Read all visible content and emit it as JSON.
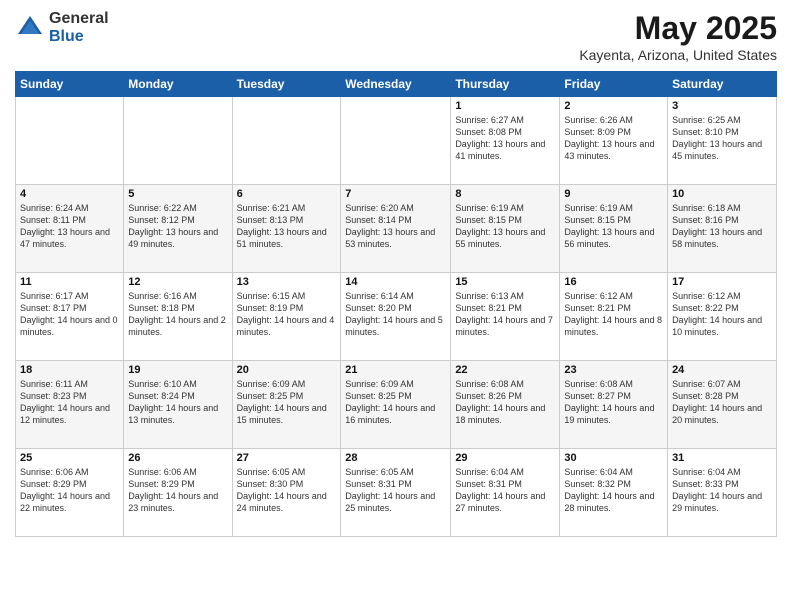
{
  "header": {
    "logo_general": "General",
    "logo_blue": "Blue",
    "main_title": "May 2025",
    "subtitle": "Kayenta, Arizona, United States"
  },
  "calendar": {
    "days_of_week": [
      "Sunday",
      "Monday",
      "Tuesday",
      "Wednesday",
      "Thursday",
      "Friday",
      "Saturday"
    ],
    "weeks": [
      [
        {
          "day": "",
          "info": ""
        },
        {
          "day": "",
          "info": ""
        },
        {
          "day": "",
          "info": ""
        },
        {
          "day": "",
          "info": ""
        },
        {
          "day": "1",
          "info": "Sunrise: 6:27 AM\nSunset: 8:08 PM\nDaylight: 13 hours\nand 41 minutes."
        },
        {
          "day": "2",
          "info": "Sunrise: 6:26 AM\nSunset: 8:09 PM\nDaylight: 13 hours\nand 43 minutes."
        },
        {
          "day": "3",
          "info": "Sunrise: 6:25 AM\nSunset: 8:10 PM\nDaylight: 13 hours\nand 45 minutes."
        }
      ],
      [
        {
          "day": "4",
          "info": "Sunrise: 6:24 AM\nSunset: 8:11 PM\nDaylight: 13 hours\nand 47 minutes."
        },
        {
          "day": "5",
          "info": "Sunrise: 6:22 AM\nSunset: 8:12 PM\nDaylight: 13 hours\nand 49 minutes."
        },
        {
          "day": "6",
          "info": "Sunrise: 6:21 AM\nSunset: 8:13 PM\nDaylight: 13 hours\nand 51 minutes."
        },
        {
          "day": "7",
          "info": "Sunrise: 6:20 AM\nSunset: 8:14 PM\nDaylight: 13 hours\nand 53 minutes."
        },
        {
          "day": "8",
          "info": "Sunrise: 6:19 AM\nSunset: 8:15 PM\nDaylight: 13 hours\nand 55 minutes."
        },
        {
          "day": "9",
          "info": "Sunrise: 6:19 AM\nSunset: 8:15 PM\nDaylight: 13 hours\nand 56 minutes."
        },
        {
          "day": "10",
          "info": "Sunrise: 6:18 AM\nSunset: 8:16 PM\nDaylight: 13 hours\nand 58 minutes."
        }
      ],
      [
        {
          "day": "11",
          "info": "Sunrise: 6:17 AM\nSunset: 8:17 PM\nDaylight: 14 hours\nand 0 minutes."
        },
        {
          "day": "12",
          "info": "Sunrise: 6:16 AM\nSunset: 8:18 PM\nDaylight: 14 hours\nand 2 minutes."
        },
        {
          "day": "13",
          "info": "Sunrise: 6:15 AM\nSunset: 8:19 PM\nDaylight: 14 hours\nand 4 minutes."
        },
        {
          "day": "14",
          "info": "Sunrise: 6:14 AM\nSunset: 8:20 PM\nDaylight: 14 hours\nand 5 minutes."
        },
        {
          "day": "15",
          "info": "Sunrise: 6:13 AM\nSunset: 8:21 PM\nDaylight: 14 hours\nand 7 minutes."
        },
        {
          "day": "16",
          "info": "Sunrise: 6:12 AM\nSunset: 8:21 PM\nDaylight: 14 hours\nand 8 minutes."
        },
        {
          "day": "17",
          "info": "Sunrise: 6:12 AM\nSunset: 8:22 PM\nDaylight: 14 hours\nand 10 minutes."
        }
      ],
      [
        {
          "day": "18",
          "info": "Sunrise: 6:11 AM\nSunset: 8:23 PM\nDaylight: 14 hours\nand 12 minutes."
        },
        {
          "day": "19",
          "info": "Sunrise: 6:10 AM\nSunset: 8:24 PM\nDaylight: 14 hours\nand 13 minutes."
        },
        {
          "day": "20",
          "info": "Sunrise: 6:09 AM\nSunset: 8:25 PM\nDaylight: 14 hours\nand 15 minutes."
        },
        {
          "day": "21",
          "info": "Sunrise: 6:09 AM\nSunset: 8:25 PM\nDaylight: 14 hours\nand 16 minutes."
        },
        {
          "day": "22",
          "info": "Sunrise: 6:08 AM\nSunset: 8:26 PM\nDaylight: 14 hours\nand 18 minutes."
        },
        {
          "day": "23",
          "info": "Sunrise: 6:08 AM\nSunset: 8:27 PM\nDaylight: 14 hours\nand 19 minutes."
        },
        {
          "day": "24",
          "info": "Sunrise: 6:07 AM\nSunset: 8:28 PM\nDaylight: 14 hours\nand 20 minutes."
        }
      ],
      [
        {
          "day": "25",
          "info": "Sunrise: 6:06 AM\nSunset: 8:29 PM\nDaylight: 14 hours\nand 22 minutes."
        },
        {
          "day": "26",
          "info": "Sunrise: 6:06 AM\nSunset: 8:29 PM\nDaylight: 14 hours\nand 23 minutes."
        },
        {
          "day": "27",
          "info": "Sunrise: 6:05 AM\nSunset: 8:30 PM\nDaylight: 14 hours\nand 24 minutes."
        },
        {
          "day": "28",
          "info": "Sunrise: 6:05 AM\nSunset: 8:31 PM\nDaylight: 14 hours\nand 25 minutes."
        },
        {
          "day": "29",
          "info": "Sunrise: 6:04 AM\nSunset: 8:31 PM\nDaylight: 14 hours\nand 27 minutes."
        },
        {
          "day": "30",
          "info": "Sunrise: 6:04 AM\nSunset: 8:32 PM\nDaylight: 14 hours\nand 28 minutes."
        },
        {
          "day": "31",
          "info": "Sunrise: 6:04 AM\nSunset: 8:33 PM\nDaylight: 14 hours\nand 29 minutes."
        }
      ]
    ]
  }
}
